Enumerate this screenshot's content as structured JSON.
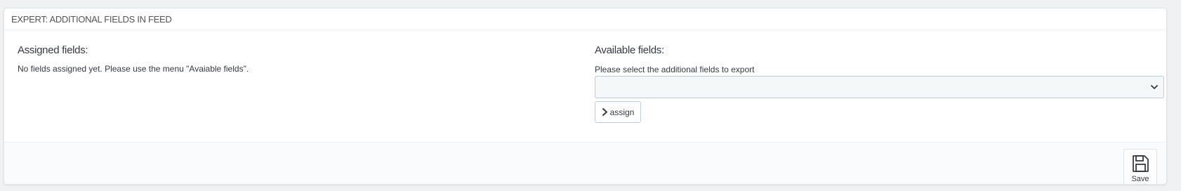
{
  "panel": {
    "title": "EXPERT: ADDITIONAL FIELDS IN FEED"
  },
  "assigned": {
    "title": "Assigned fields:",
    "empty_text": "No fields assigned yet. Please use the menu \"Avaiable fields\"."
  },
  "available": {
    "title": "Available fields:",
    "help": "Please select the additional fields to export",
    "select_value": "",
    "assign_label": "assign"
  },
  "footer": {
    "save_label": "Save"
  },
  "icons": {
    "assign": "chevron-right-icon",
    "select": "chevron-down-icon",
    "save": "floppy-disk-icon"
  }
}
